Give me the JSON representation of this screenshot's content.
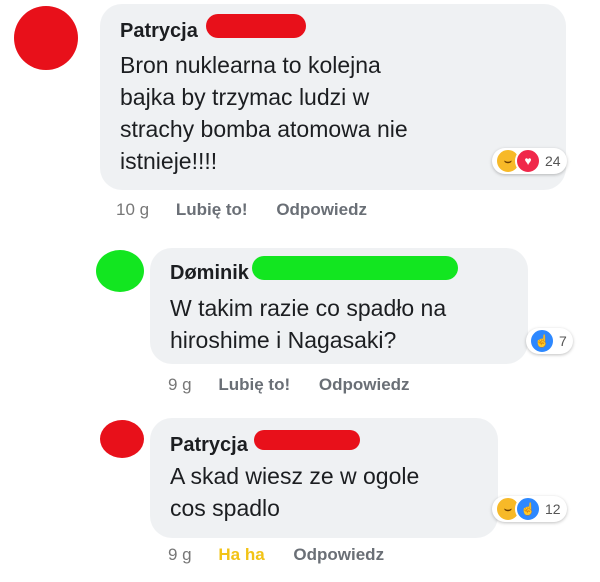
{
  "colors": {
    "bubble": "#eff1f3",
    "redact_red": "#e8101a",
    "redact_green": "#12e620",
    "meta_text": "#6a6f76",
    "haha_active": "#f2c316"
  },
  "comments": [
    {
      "author": "Patrycja",
      "text": "Bron nuklearna to kolejna\nbajka by trzymac ludzi w\nstrachy bomba atomowa nie\nistnieje!!!!",
      "reactions": {
        "icons": [
          "haha-icon",
          "love-icon"
        ],
        "count": "24"
      },
      "time": "10 g",
      "like_label": "Lubię to!",
      "reply_label": "Odpowiedz"
    },
    {
      "author": "Døminik",
      "text": "W takim razie co spadło na\nhiroshime i Nagasaki?",
      "reactions": {
        "icons": [
          "like-icon"
        ],
        "count": "7"
      },
      "time": "9 g",
      "like_label": "Lubię to!",
      "reply_label": "Odpowiedz"
    },
    {
      "author": "Patrycja",
      "text": "A skad wiesz ze w ogole\ncos spadlo",
      "reactions": {
        "icons": [
          "haha-icon",
          "like-icon"
        ],
        "count": "12"
      },
      "time": "9 g",
      "like_label": "Ha ha",
      "reply_label": "Odpowiedz"
    }
  ]
}
